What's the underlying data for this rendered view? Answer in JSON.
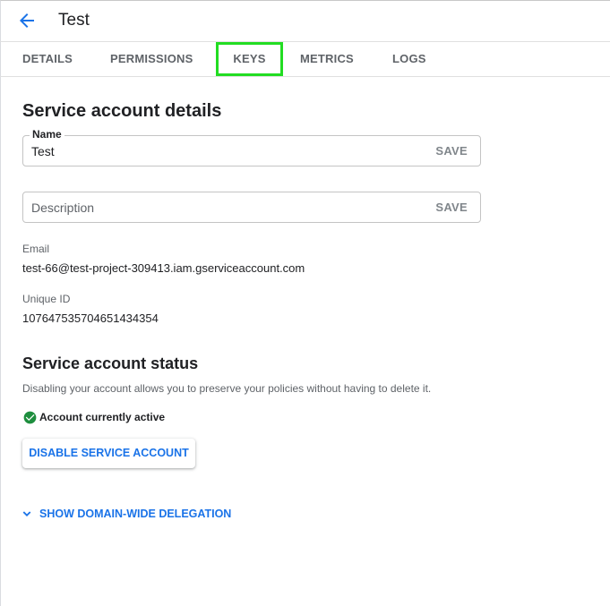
{
  "header": {
    "back_icon": "arrow-back-icon",
    "title": "Test"
  },
  "tabs": [
    {
      "label": "DETAILS"
    },
    {
      "label": "PERMISSIONS"
    },
    {
      "label": "KEYS"
    },
    {
      "label": "METRICS"
    },
    {
      "label": "LOGS"
    }
  ],
  "details": {
    "section_title": "Service account details",
    "name_field": {
      "label": "Name",
      "value": "Test",
      "save_label": "SAVE"
    },
    "description_field": {
      "placeholder": "Description",
      "save_label": "SAVE"
    },
    "email": {
      "label": "Email",
      "value": "test-66@test-project-309413.iam.gserviceaccount.com"
    },
    "unique_id": {
      "label": "Unique ID",
      "value": "107647535704651434354"
    }
  },
  "status": {
    "section_title": "Service account status",
    "help_text": "Disabling your account allows you to preserve your policies without having to delete it.",
    "status_text": "Account currently active",
    "status_icon": "check-circle-icon",
    "status_color": "#1e8e3e",
    "disable_button_label": "DISABLE SERVICE ACCOUNT"
  },
  "delegation": {
    "icon": "chevron-down-icon",
    "label": "SHOW DOMAIN-WIDE DELEGATION"
  },
  "colors": {
    "accent": "#1a73e8",
    "highlight_box": "#22dd22"
  }
}
